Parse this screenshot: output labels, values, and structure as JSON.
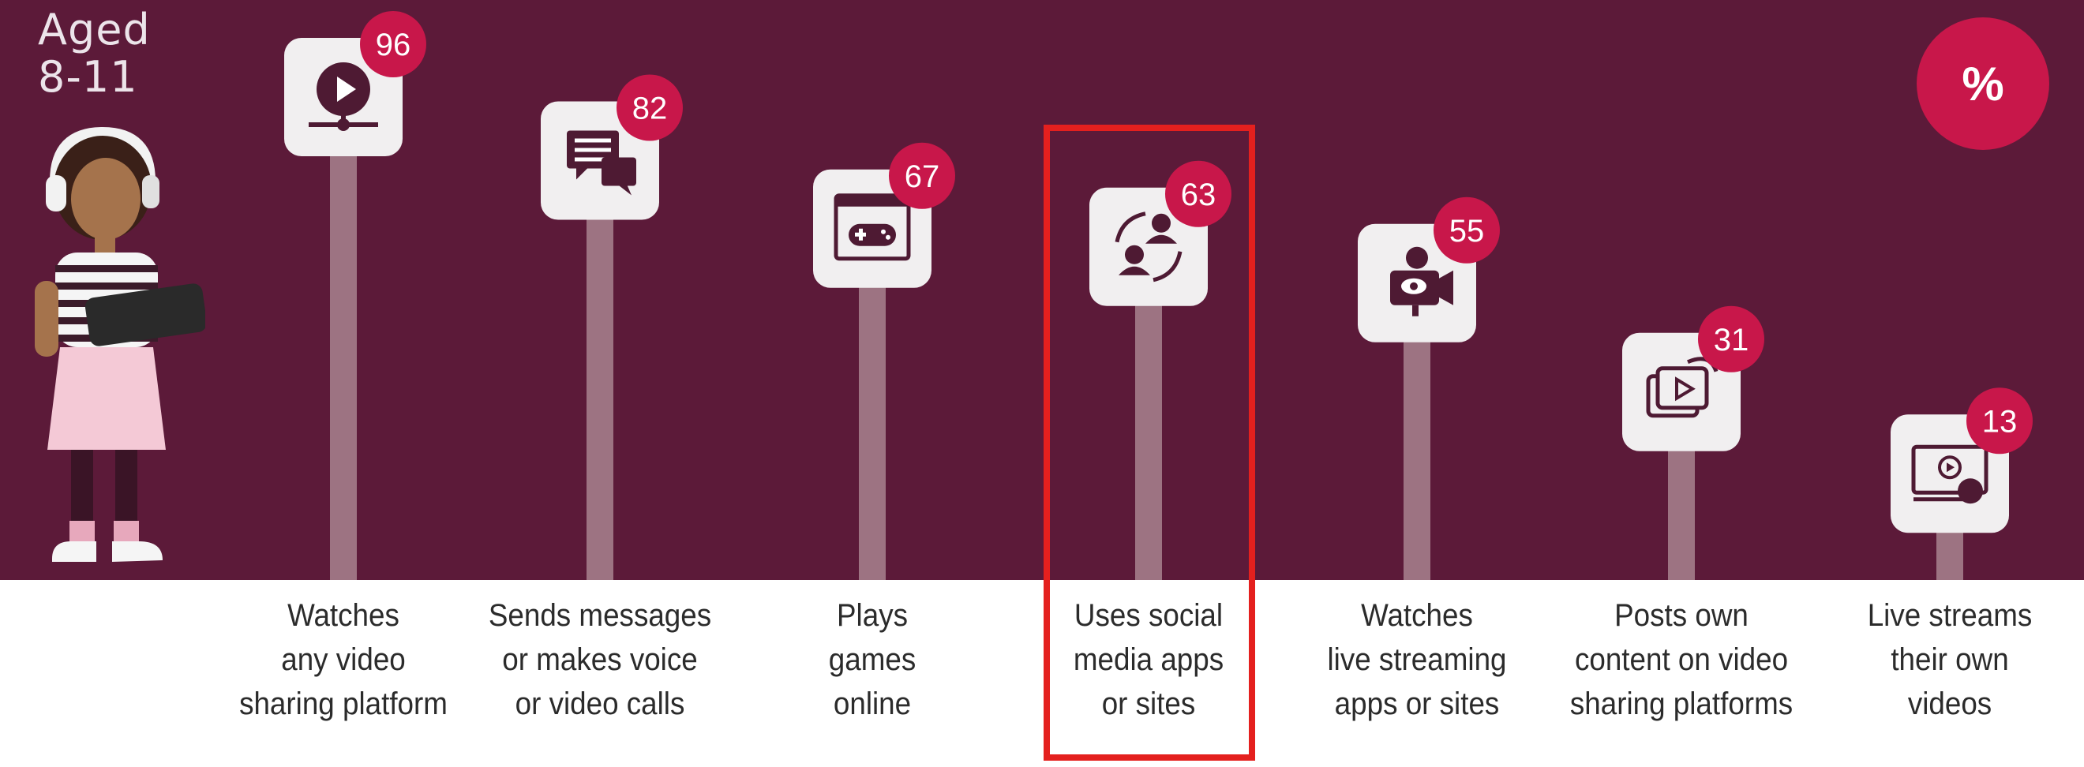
{
  "age_group": {
    "line1": "Aged",
    "line2": "8-11"
  },
  "unit_badge": "%",
  "colors": {
    "background": "#5c1a39",
    "stem": "#9d7382",
    "icon_tile": "#f1eff0",
    "icon_glyph": "#4e1a33",
    "value_badge": "#c8174a",
    "highlight": "#e4201e"
  },
  "chart_data": {
    "type": "bar",
    "title": "",
    "xlabel": "",
    "ylabel": "",
    "ylim": [
      0,
      100
    ],
    "categories": [
      [
        "Watches",
        "any video",
        "sharing platform"
      ],
      [
        "Sends messages",
        "or makes voice",
        "or video calls"
      ],
      [
        "Plays",
        "games",
        "online"
      ],
      [
        "Uses social",
        "media apps",
        "or sites"
      ],
      [
        "Watches",
        "live streaming",
        "apps or sites"
      ],
      [
        "Posts own",
        "content on video",
        "sharing platforms"
      ],
      [
        "Live streams",
        "their own",
        "videos"
      ]
    ],
    "values": [
      96,
      82,
      67,
      63,
      55,
      31,
      13
    ],
    "icons": [
      "video-play-icon",
      "chat-bubbles-icon",
      "game-controller-icon",
      "social-people-icon",
      "video-camera-icon",
      "share-video-icon",
      "live-stream-icon"
    ],
    "highlighted_category_index": 3
  }
}
